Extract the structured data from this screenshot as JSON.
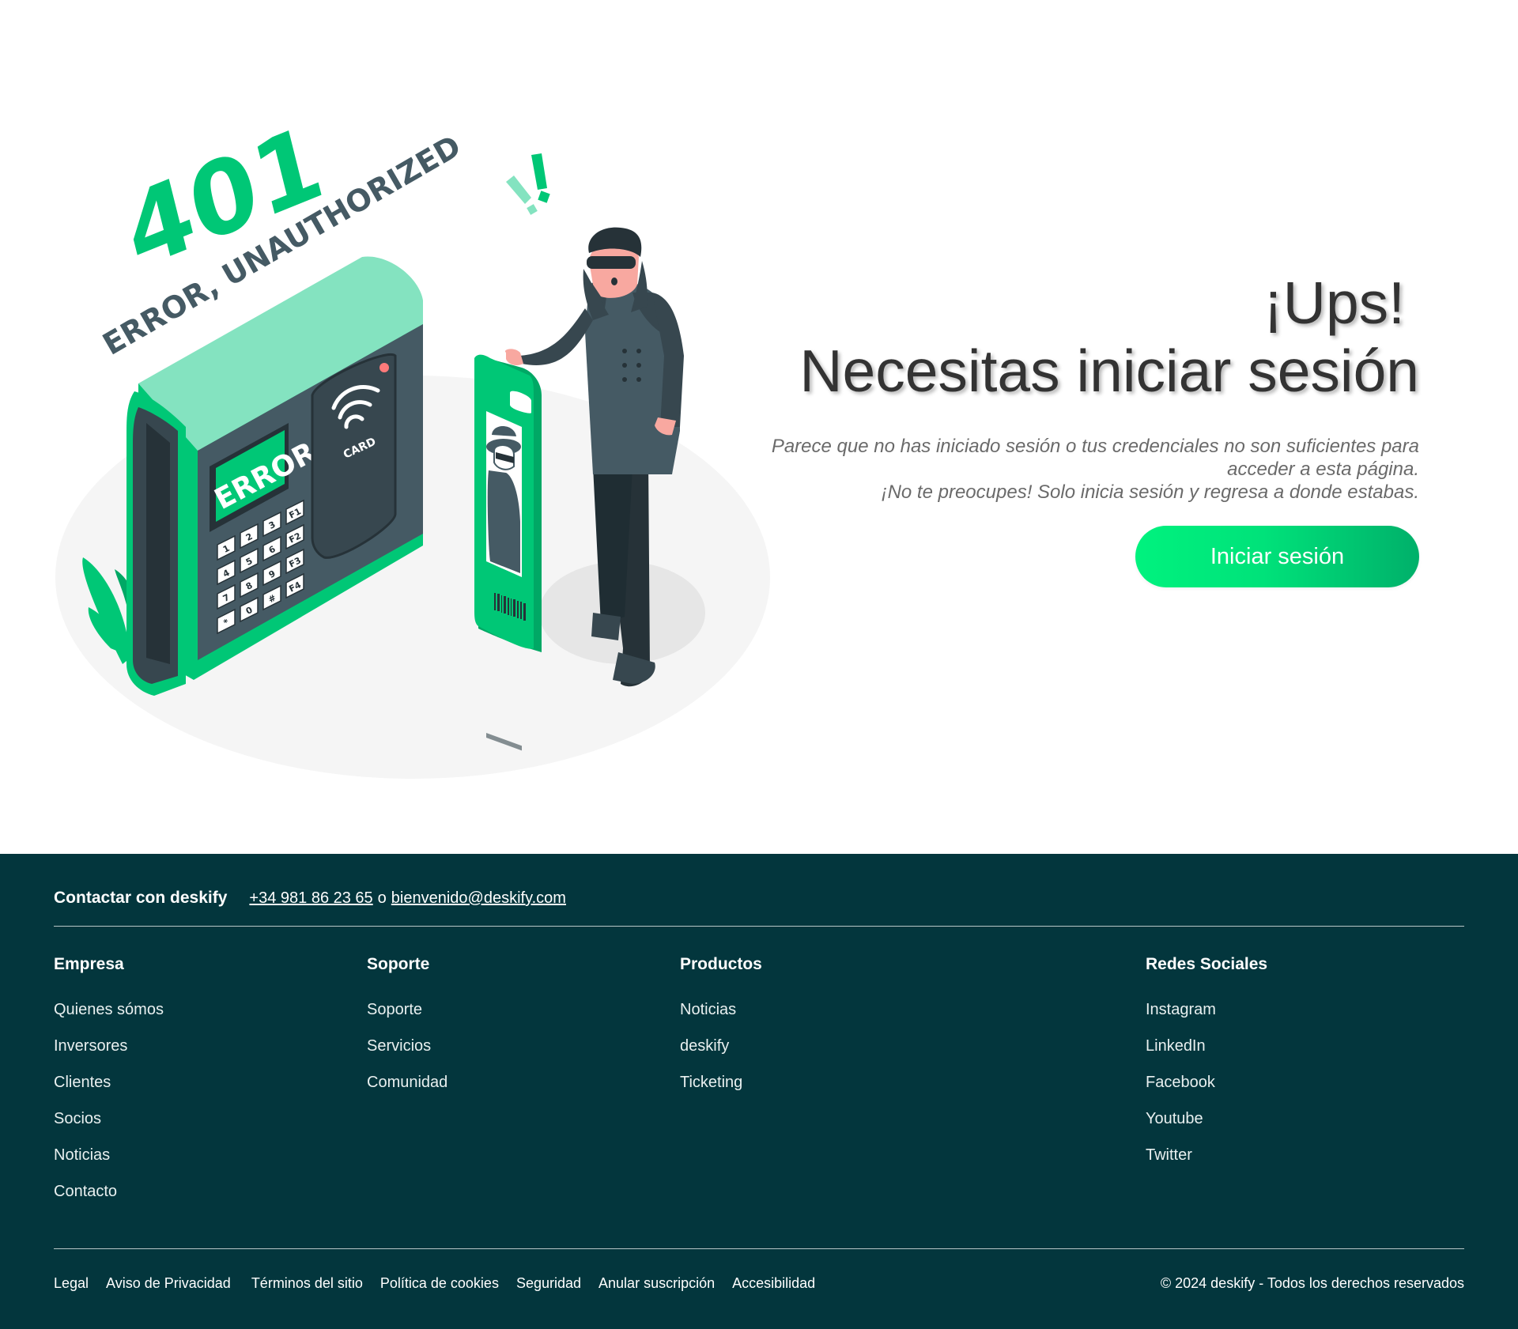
{
  "hero": {
    "illustration": {
      "code": "401",
      "caption": "ERROR, UNAUTHORIZED",
      "screen_text": "ERROR",
      "reader_label": "CARD",
      "keys": [
        "1",
        "2",
        "3",
        "F1",
        "4",
        "5",
        "6",
        "F2",
        "7",
        "8",
        "9",
        "F3",
        "*",
        "0",
        "#",
        "F4"
      ]
    },
    "title_line1": "¡Ups!",
    "title_line2": "Necesitas iniciar sesión",
    "description_line1": "Parece que no has iniciado sesión o tus credenciales no son suficientes para",
    "description_line2": "acceder a esta página.",
    "description_line3": "¡No te preocupes! Solo inicia sesión y regresa a donde estabas.",
    "cta_label": "Iniciar sesión"
  },
  "footer": {
    "contact_label": "Contactar con deskify",
    "phone": "+34 981 86 23 65",
    "separator": "o",
    "email": "bienvenido@deskify.com",
    "columns": [
      {
        "title": "Empresa",
        "items": [
          "Quienes sómos",
          "Inversores",
          "Clientes",
          "Socios",
          "Noticias",
          "Contacto"
        ]
      },
      {
        "title": "Soporte",
        "items": [
          "Soporte",
          "Servicios",
          "Comunidad"
        ]
      },
      {
        "title": "Productos",
        "items": [
          "Noticias",
          "deskify",
          "Ticketing"
        ]
      },
      {
        "title": "Redes Sociales",
        "items": [
          "Instagram",
          "LinkedIn",
          "Facebook",
          "Youtube",
          "Twitter"
        ]
      }
    ],
    "legal_links": [
      "Legal",
      "Aviso de Privacidad",
      "Términos del sitio",
      "Política de cookies",
      "Seguridad",
      "Anular suscripción",
      "Accesibilidad"
    ],
    "copyright": "© 2024 deskify - Todos los derechos reservados"
  },
  "colors": {
    "accent_green": "#00c776",
    "light_green": "#84e3c0",
    "dark_slate": "#455a64",
    "footer_bg": "#03363d"
  }
}
